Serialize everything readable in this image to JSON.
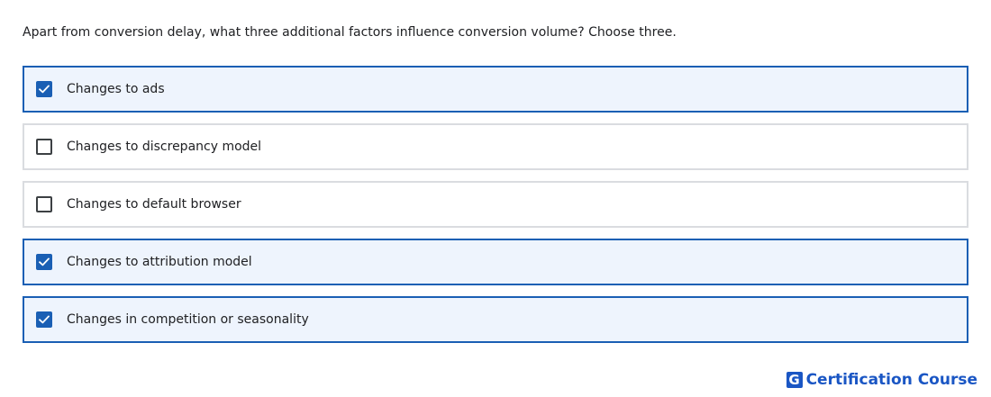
{
  "question": {
    "text": "Apart from conversion delay, what three additional factors influence conversion volume? Choose three."
  },
  "options": [
    {
      "label": "Changes to ads",
      "checked": true
    },
    {
      "label": "Changes to discrepancy model",
      "checked": false
    },
    {
      "label": "Changes to default browser",
      "checked": false
    },
    {
      "label": "Changes to attribution model",
      "checked": true
    },
    {
      "label": "Changes in competition or seasonality",
      "checked": true
    }
  ],
  "brand": {
    "logo_letter": "G",
    "text": "Certification Course"
  },
  "colors": {
    "accent": "#1a5fb4",
    "selected_background": "#eef4fd",
    "unselected_border": "#dadce0",
    "brand": "#1a56c4"
  },
  "icons": {
    "checked": "check-icon"
  }
}
